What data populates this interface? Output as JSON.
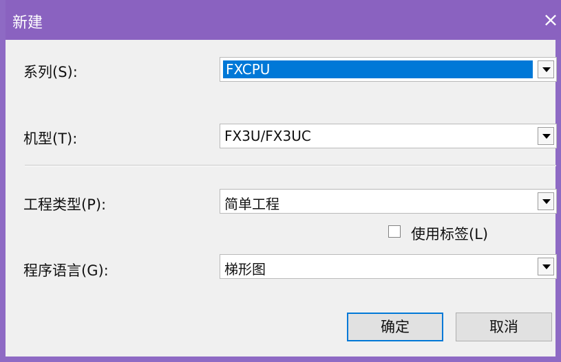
{
  "window": {
    "title": "新建"
  },
  "fields": {
    "series": {
      "label": "系列(S):",
      "value": "FXCPU"
    },
    "model": {
      "label": "机型(T):",
      "value": "FX3U/FX3UC"
    },
    "project_type": {
      "label": "工程类型(P):",
      "value": "简单工程"
    },
    "use_labels": {
      "label": "使用标签(L)",
      "checked": false
    },
    "program_language": {
      "label": "程序语言(G):",
      "value": "梯形图"
    }
  },
  "buttons": {
    "ok": "确定",
    "cancel": "取消"
  },
  "icons": {
    "close": "×"
  },
  "colors": {
    "titlebar": "#8a62c0",
    "selection": "#0078d7"
  }
}
